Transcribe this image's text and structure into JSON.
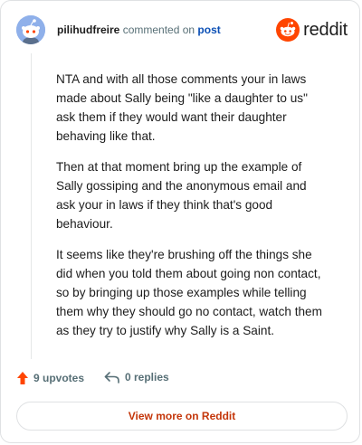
{
  "header": {
    "username": "pilihudfreire",
    "action_text": "commented on",
    "post_link": "post",
    "brand": "reddit"
  },
  "comment": {
    "paragraphs": [
      "NTA and with all those comments your in laws made about Sally being \"like a daughter to us\" ask them if they would want their daughter behaving like that.",
      "Then at that moment bring up the example of Sally gossiping and the anonymous email and ask your in laws if they think that's good behaviour.",
      "It seems like they're brushing off the things she did when you told them about going non contact, so by bringing up those examples while telling them why they should go no contact, watch them as they try to justify why Sally is a Saint."
    ]
  },
  "actions": {
    "upvotes": "9 upvotes",
    "replies": "0 replies"
  },
  "footer": {
    "view_more": "View more on Reddit"
  },
  "colors": {
    "brand_orange": "#ff4500",
    "link_blue": "#0b4fb5",
    "view_more_red": "#c4360a",
    "avatar_blue": "#8fb0ea"
  },
  "icons": [
    "snoo-avatar-icon",
    "reddit-logo-icon",
    "upvote-arrow-icon",
    "reply-arrow-icon"
  ]
}
